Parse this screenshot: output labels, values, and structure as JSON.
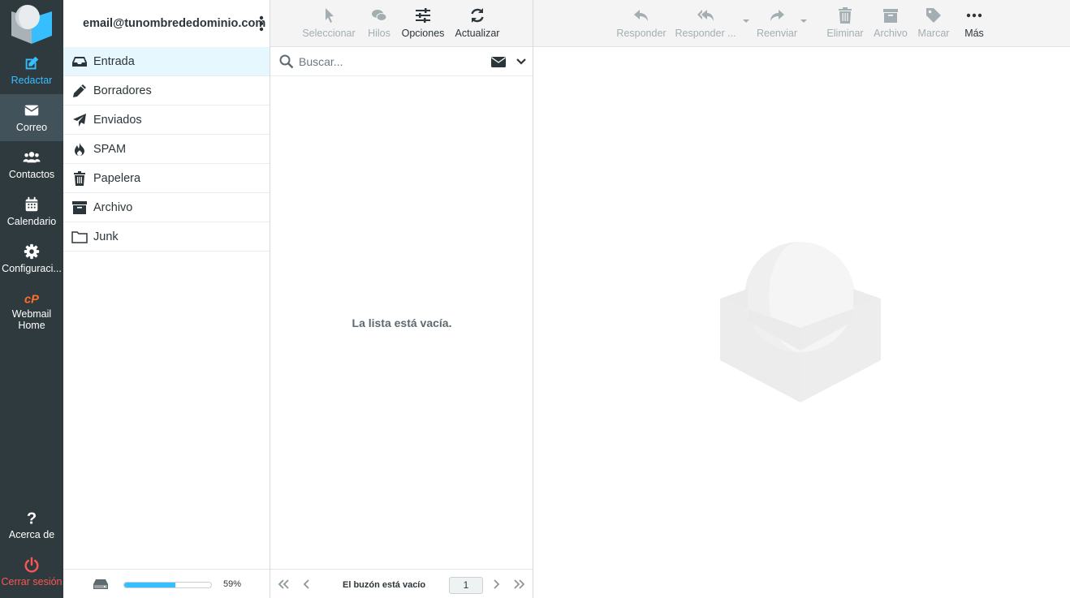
{
  "nav": {
    "compose": "Redactar",
    "mail": "Correo",
    "contacts": "Contactos",
    "calendar": "Calendario",
    "settings": "Configuraci...",
    "webmail_home": "Webmail Home",
    "about": "Acerca de",
    "logout": "Cerrar sesión"
  },
  "account": {
    "email": "email@tunombrededominio.com"
  },
  "folders": [
    {
      "label": "Entrada",
      "icon": "inbox-icon"
    },
    {
      "label": "Borradores",
      "icon": "pencil-icon"
    },
    {
      "label": "Enviados",
      "icon": "paper-plane-icon"
    },
    {
      "label": "SPAM",
      "icon": "fire-icon"
    },
    {
      "label": "Papelera",
      "icon": "trash-icon"
    },
    {
      "label": "Archivo",
      "icon": "archive-box-icon"
    },
    {
      "label": "Junk",
      "icon": "folder-icon"
    }
  ],
  "quota": {
    "percent_text": "59%",
    "fill": 0.59
  },
  "list_toolbar": {
    "select": "Seleccionar",
    "threads": "Hilos",
    "options": "Opciones",
    "refresh": "Actualizar"
  },
  "search": {
    "placeholder": "Buscar..."
  },
  "list": {
    "empty": "La lista está vacía."
  },
  "pager": {
    "status": "El buzón está vacío",
    "page": "1"
  },
  "msg_toolbar": {
    "reply": "Responder",
    "reply_all": "Responder ...",
    "forward": "Reenviar",
    "delete": "Eliminar",
    "archive": "Archivo",
    "mark": "Marcar",
    "more": "Más"
  },
  "colors": {
    "nav_bg": "#2f3a3f",
    "nav_active": "#41525a",
    "accent": "#37beff",
    "logout": "#ff5552",
    "cpanel": "#ff6c2c",
    "selected_folder": "#e6f8fd"
  }
}
